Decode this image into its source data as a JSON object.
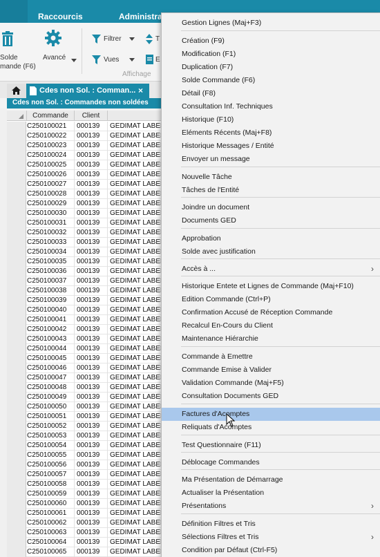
{
  "topbar": {
    "menu_shortcuts": "Raccourcis",
    "menu_admin": "Administrati"
  },
  "ribbon": {
    "solde_line1": "Solde",
    "solde_line2": "mande (F6)",
    "avance": "Avancé",
    "filtrer": "Filtrer",
    "vues": "Vues",
    "affichage": "Affichage",
    "partial_t": "T",
    "partial_e": "E"
  },
  "tabs": {
    "active_tab": "Cdes non Sol. : Comman...",
    "close": "×",
    "subtitle": "Cdes non Sol. : Commandes non soldées"
  },
  "grid": {
    "columns": [
      "Commande",
      "Client"
    ],
    "rows": [
      {
        "commande": "C250100021",
        "client": "000139",
        "name": "GEDIMAT LABEN"
      },
      {
        "commande": "C250100022",
        "client": "000139",
        "name": "GEDIMAT LABEN"
      },
      {
        "commande": "C250100023",
        "client": "000139",
        "name": "GEDIMAT LABEN"
      },
      {
        "commande": "C250100024",
        "client": "000139",
        "name": "GEDIMAT LABEN"
      },
      {
        "commande": "C250100025",
        "client": "000139",
        "name": "GEDIMAT LABEN"
      },
      {
        "commande": "C250100026",
        "client": "000139",
        "name": "GEDIMAT LABEN"
      },
      {
        "commande": "C250100027",
        "client": "000139",
        "name": "GEDIMAT LABEN"
      },
      {
        "commande": "C250100028",
        "client": "000139",
        "name": "GEDIMAT LABEN"
      },
      {
        "commande": "C250100029",
        "client": "000139",
        "name": "GEDIMAT LABEN"
      },
      {
        "commande": "C250100030",
        "client": "000139",
        "name": "GEDIMAT LABEN"
      },
      {
        "commande": "C250100031",
        "client": "000139",
        "name": "GEDIMAT LABEN"
      },
      {
        "commande": "C250100032",
        "client": "000139",
        "name": "GEDIMAT LABEN"
      },
      {
        "commande": "C250100033",
        "client": "000139",
        "name": "GEDIMAT LABEN"
      },
      {
        "commande": "C250100034",
        "client": "000139",
        "name": "GEDIMAT LABEN"
      },
      {
        "commande": "C250100035",
        "client": "000139",
        "name": "GEDIMAT LABEN"
      },
      {
        "commande": "C250100036",
        "client": "000139",
        "name": "GEDIMAT LABEN"
      },
      {
        "commande": "C250100037",
        "client": "000139",
        "name": "GEDIMAT LABEN"
      },
      {
        "commande": "C250100038",
        "client": "000139",
        "name": "GEDIMAT LABEN"
      },
      {
        "commande": "C250100039",
        "client": "000139",
        "name": "GEDIMAT LABEN"
      },
      {
        "commande": "C250100040",
        "client": "000139",
        "name": "GEDIMAT LABEN"
      },
      {
        "commande": "C250100041",
        "client": "000139",
        "name": "GEDIMAT LABEN"
      },
      {
        "commande": "C250100042",
        "client": "000139",
        "name": "GEDIMAT LABEN"
      },
      {
        "commande": "C250100043",
        "client": "000139",
        "name": "GEDIMAT LABEN"
      },
      {
        "commande": "C250100044",
        "client": "000139",
        "name": "GEDIMAT LABEN"
      },
      {
        "commande": "C250100045",
        "client": "000139",
        "name": "GEDIMAT LABEN"
      },
      {
        "commande": "C250100046",
        "client": "000139",
        "name": "GEDIMAT LABEN"
      },
      {
        "commande": "C250100047",
        "client": "000139",
        "name": "GEDIMAT LABEN"
      },
      {
        "commande": "C250100048",
        "client": "000139",
        "name": "GEDIMAT LABEN"
      },
      {
        "commande": "C250100049",
        "client": "000139",
        "name": "GEDIMAT LABEN"
      },
      {
        "commande": "C250100050",
        "client": "000139",
        "name": "GEDIMAT LABEN"
      },
      {
        "commande": "C250100051",
        "client": "000139",
        "name": "GEDIMAT LABEN"
      },
      {
        "commande": "C250100052",
        "client": "000139",
        "name": "GEDIMAT LABEN"
      },
      {
        "commande": "C250100053",
        "client": "000139",
        "name": "GEDIMAT LABEN"
      },
      {
        "commande": "C250100054",
        "client": "000139",
        "name": "GEDIMAT LABEN"
      },
      {
        "commande": "C250100055",
        "client": "000139",
        "name": "GEDIMAT LABEN"
      },
      {
        "commande": "C250100056",
        "client": "000139",
        "name": "GEDIMAT LABEN"
      },
      {
        "commande": "C250100057",
        "client": "000139",
        "name": "GEDIMAT LABEN"
      },
      {
        "commande": "C250100058",
        "client": "000139",
        "name": "GEDIMAT LABEN"
      },
      {
        "commande": "C250100059",
        "client": "000139",
        "name": "GEDIMAT LABEN"
      },
      {
        "commande": "C250100060",
        "client": "000139",
        "name": "GEDIMAT LABEN"
      },
      {
        "commande": "C250100061",
        "client": "000139",
        "name": "GEDIMAT LABEN"
      },
      {
        "commande": "C250100062",
        "client": "000139",
        "name": "GEDIMAT LABEN"
      },
      {
        "commande": "C250100063",
        "client": "000139",
        "name": "GEDIMAT LABEN"
      },
      {
        "commande": "C250100064",
        "client": "000139",
        "name": "GEDIMAT LABEN"
      },
      {
        "commande": "C250100065",
        "client": "000139",
        "name": "GEDIMAT LABEN"
      }
    ]
  },
  "context_menu": {
    "items": [
      {
        "label": "Gestion Lignes (Maj+F3)"
      },
      {
        "label": "Création (F9)"
      },
      {
        "label": "Modification (F1)"
      },
      {
        "label": "Duplication (F7)"
      },
      {
        "label": "Solde Commande (F6)"
      },
      {
        "label": "Détail (F8)"
      },
      {
        "label": "Consultation Inf. Techniques"
      },
      {
        "label": "Historique (F10)"
      },
      {
        "label": "Eléments Récents (Maj+F8)"
      },
      {
        "label": "Historique Messages / Entité"
      },
      {
        "label": "Envoyer un message"
      },
      {
        "label": "Nouvelle Tâche"
      },
      {
        "label": "Tâches de l'Entité"
      },
      {
        "label": "Joindre un document"
      },
      {
        "label": "Documents GED"
      },
      {
        "label": "Approbation"
      },
      {
        "label": "Solde avec justification"
      },
      {
        "label": "Accès à ...",
        "submenu": true
      },
      {
        "label": "Historique Entete et Lignes de Commande (Maj+F10)"
      },
      {
        "label": "Edition Commande (Ctrl+P)"
      },
      {
        "label": "Confirmation Accusé de Réception Commande"
      },
      {
        "label": "Recalcul En-Cours du Client"
      },
      {
        "label": "Maintenance Hiérarchie"
      },
      {
        "label": "Commande à Emettre"
      },
      {
        "label": "Commande Emise à Valider"
      },
      {
        "label": "Validation Commande (Maj+F5)"
      },
      {
        "label": "Consultation Documents GED"
      },
      {
        "label": "Factures d'Acomptes",
        "highlighted": true
      },
      {
        "label": "Reliquats d'Acomptes"
      },
      {
        "label": "Test Questionnaire (F11)"
      },
      {
        "label": "Déblocage Commandes"
      },
      {
        "label": "Ma Présentation de Démarrage"
      },
      {
        "label": "Actualiser la Présentation"
      },
      {
        "label": "Présentations",
        "submenu": true
      },
      {
        "label": "Définition Filtres et Tris"
      },
      {
        "label": "Sélections Filtres et Tris",
        "submenu": true
      },
      {
        "label": "Condition par Défaut (Ctrl-F5)"
      }
    ],
    "submenu_glyph": "›"
  },
  "colors": {
    "brand": "#1a8aa8",
    "highlight": "#a9c8ec",
    "menu_bg": "#f2f2f2"
  }
}
